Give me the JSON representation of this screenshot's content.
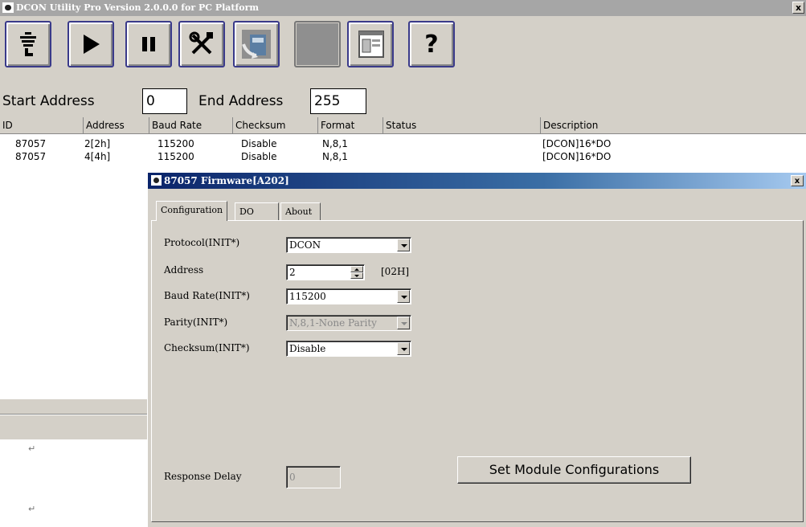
{
  "window": {
    "title": "DCON Utility Pro Version 2.0.0.0 for PC Platform",
    "close": "x"
  },
  "toolbar": {
    "buttons": [
      {
        "name": "search-icon"
      },
      {
        "name": "play-icon"
      },
      {
        "name": "pause-icon"
      },
      {
        "name": "tools-icon"
      },
      {
        "name": "module-icon"
      },
      {
        "name": "blank-icon"
      },
      {
        "name": "window-icon"
      },
      {
        "name": "help-icon",
        "glyph": "?"
      }
    ]
  },
  "address": {
    "start_label": "Start Address",
    "start_value": "0",
    "end_label": "End Address",
    "end_value": "255"
  },
  "list": {
    "columns": [
      "ID",
      "Address",
      "Baud Rate",
      "Checksum",
      "Format",
      "Status",
      "Description"
    ],
    "rows": [
      {
        "id": "87057",
        "address": "2[2h]",
        "baud": "115200",
        "checksum": "Disable",
        "format": "N,8,1",
        "status": "",
        "description": "[DCON]16*DO"
      },
      {
        "id": "87057",
        "address": "4[4h]",
        "baud": "115200",
        "checksum": "Disable",
        "format": "N,8,1",
        "status": "",
        "description": "[DCON]16*DO"
      }
    ]
  },
  "marks": {
    "enter1": "↵",
    "enter2": "↵"
  },
  "dialog": {
    "title": "87057 Firmware[A202]",
    "close": "x",
    "tabs": [
      "Configuration",
      "DO",
      "About"
    ],
    "fields": {
      "protocol_label": "Protocol(INIT*)",
      "protocol_value": "DCON",
      "address_label": "Address",
      "address_value": "2",
      "address_hex": "[02H]",
      "baud_label": "Baud Rate(INIT*)",
      "baud_value": "115200",
      "parity_label": "Parity(INIT*)",
      "parity_value": "N,8,1-None Parity",
      "checksum_label": "Checksum(INIT*)",
      "checksum_value": "Disable",
      "delay_label": "Response Delay",
      "delay_value": "0"
    },
    "set_button": "Set Module Configurations"
  },
  "colors": {
    "title_gray": "#a6a6a6",
    "face": "#d4d0c8",
    "dialog_title": "#0a246a",
    "button_border": "#3a3a8a"
  }
}
